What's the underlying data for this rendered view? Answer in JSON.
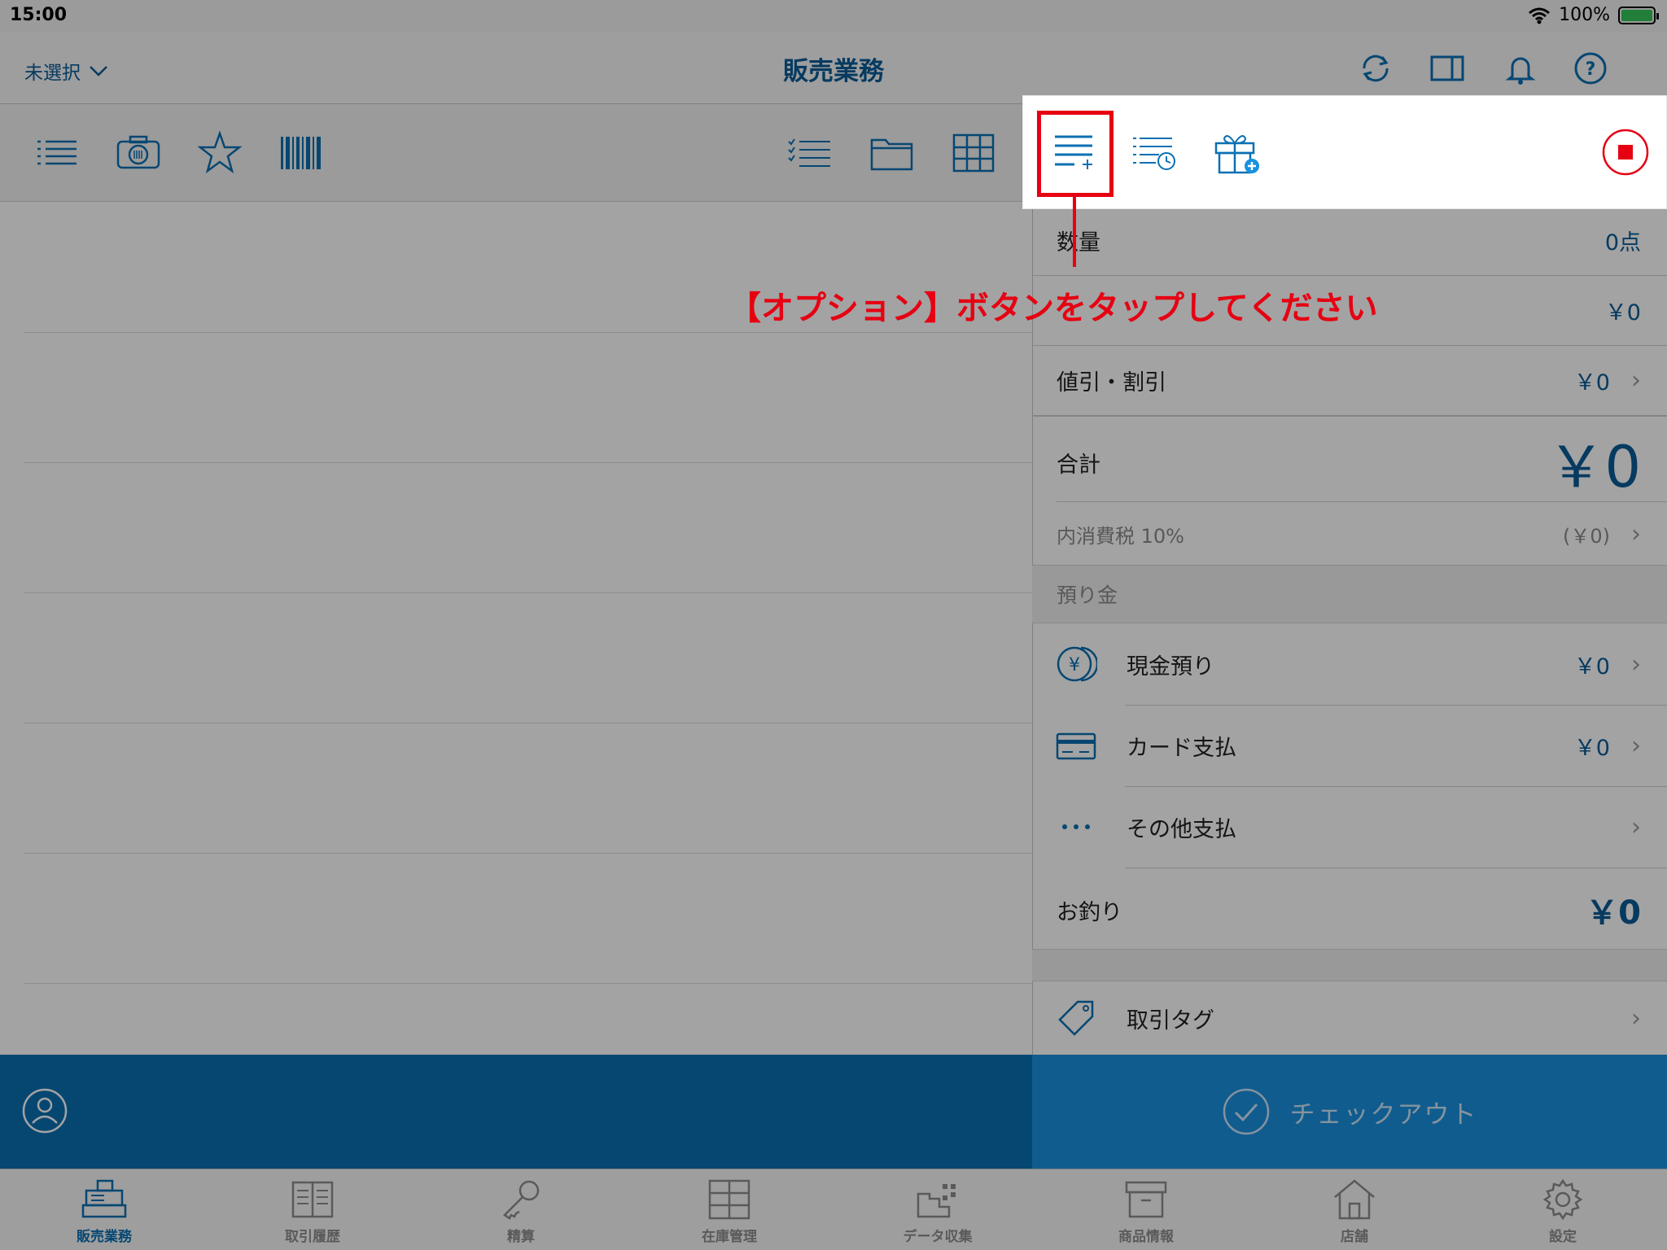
{
  "status": {
    "time": "15:00",
    "battery": "100%"
  },
  "nav": {
    "store_select": "未選択",
    "title": "販売業務"
  },
  "callout": {
    "text": "【オプション】ボタンをタップしてください"
  },
  "summary": {
    "quantity_label": "数量",
    "quantity_value": "0点",
    "subtotal_value": "￥0",
    "discount_label": "値引・割引",
    "discount_value": "￥0",
    "total_label": "合計",
    "total_value": "￥0",
    "tax_label": "内消費税 10%",
    "tax_value": "(￥0)"
  },
  "deposit": {
    "header": "預り金",
    "cash_label": "現金預り",
    "cash_value": "￥0",
    "card_label": "カード支払",
    "card_value": "￥0",
    "other_label": "その他支払"
  },
  "change": {
    "label": "お釣り",
    "value": "￥0"
  },
  "tag": {
    "label": "取引タグ"
  },
  "checkout": {
    "label": "チェックアウト"
  },
  "tabs": [
    {
      "label": "販売業務",
      "icon": "register-icon"
    },
    {
      "label": "取引履歴",
      "icon": "book-icon"
    },
    {
      "label": "精算",
      "icon": "key-icon"
    },
    {
      "label": "在庫管理",
      "icon": "cabinet-icon"
    },
    {
      "label": "データ収集",
      "icon": "data-collect-icon"
    },
    {
      "label": "商品情報",
      "icon": "box-icon"
    },
    {
      "label": "店舗",
      "icon": "store-icon"
    },
    {
      "label": "設定",
      "icon": "gear-icon"
    }
  ],
  "colors": {
    "brand": "#0a70b3",
    "accent_text": "#0a5c96",
    "callout": "#e60012",
    "record": "#e60012"
  }
}
